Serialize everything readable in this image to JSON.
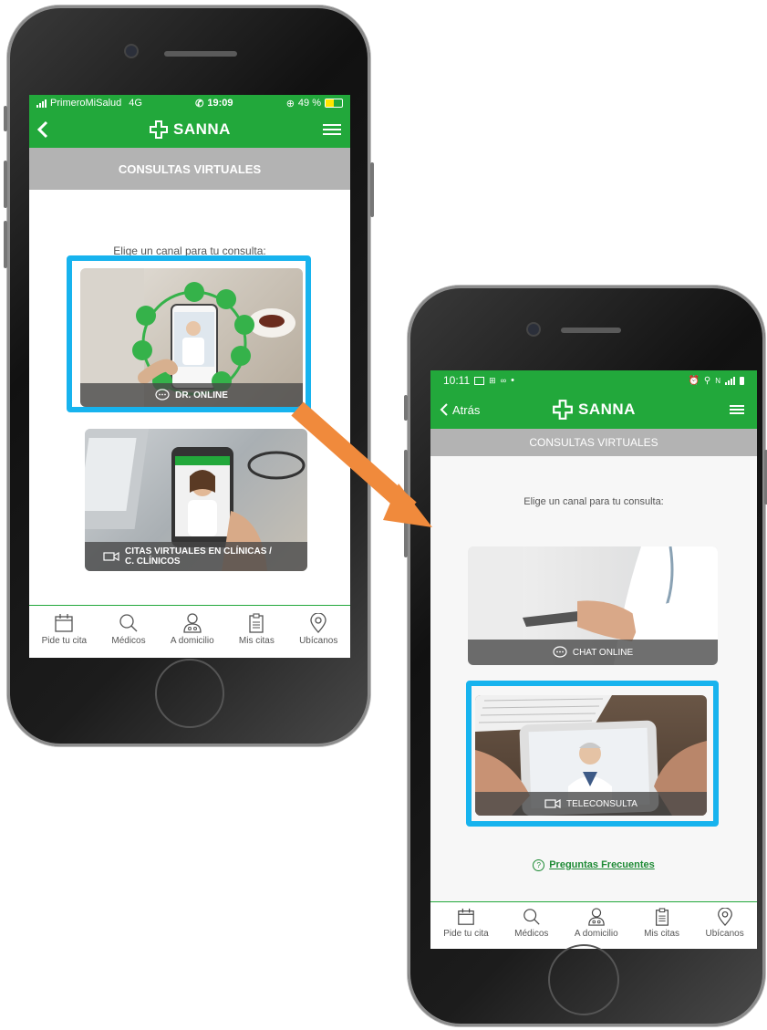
{
  "phone1": {
    "status": {
      "carrier": "PrimeroMiSalud",
      "network": "4G",
      "time": "19:09",
      "battery": "49 %"
    },
    "brand": "SANNA",
    "section_title": "CONSULTAS VIRTUALES",
    "prompt": "Elige un canal para tu consulta:",
    "cards": [
      {
        "label": "DR. ONLINE",
        "icon": "chat-bubble-icon"
      },
      {
        "label": "CITAS VIRTUALES EN CLÍNICAS /\nC. CLÍNICOS",
        "icon": "video-camera-icon"
      }
    ],
    "tabs": [
      "Pide tu cita",
      "Médicos",
      "A domicilio",
      "Mis citas",
      "Ubícanos"
    ]
  },
  "phone2": {
    "status": {
      "time": "10:11"
    },
    "back_label": "Atrás",
    "brand": "SANNA",
    "section_title": "CONSULTAS VIRTUALES",
    "prompt": "Elige un canal para tu consulta:",
    "cards": [
      {
        "label": "CHAT ONLINE",
        "icon": "chat-bubble-icon"
      },
      {
        "label": "TELECONSULTA",
        "icon": "video-camera-icon"
      }
    ],
    "faq": "Preguntas Frecuentes",
    "tabs": [
      "Pide tu cita",
      "Médicos",
      "A domicilio",
      "Mis citas",
      "Ubícanos"
    ]
  },
  "colors": {
    "brand_green": "#22a83b",
    "highlight_blue": "#17b3ee",
    "arrow_orange": "#f08a3c",
    "section_gray": "#b3b3b3"
  }
}
